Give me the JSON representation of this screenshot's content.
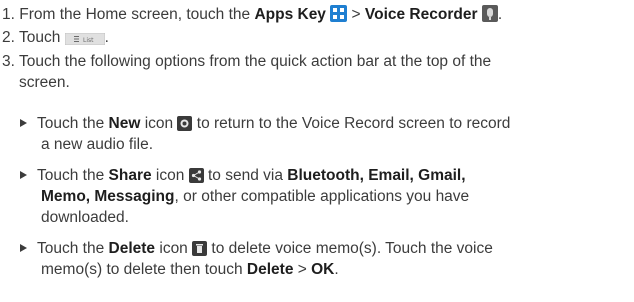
{
  "step1": {
    "num": "1.",
    "t1": "From the Home screen, touch the ",
    "apps_key": "Apps Key",
    "gt": " > ",
    "voice_recorder": "Voice Recorder",
    "t2": "."
  },
  "step2": {
    "num": "2.",
    "t1": "Touch ",
    "list_button": "List",
    "t2": "."
  },
  "step3": {
    "num": "3.",
    "line1": "Touch the following options from the quick action bar at the top of the",
    "line2": "screen."
  },
  "bullet_new": {
    "t1": "Touch the ",
    "b1": "New",
    "t2": " icon ",
    "t3": " to return to the Voice Record screen to record",
    "line2": "a new audio file."
  },
  "bullet_share": {
    "t1": "Touch the ",
    "b1": "Share",
    "t2": " icon ",
    "t3": " to send via ",
    "b2": "Bluetooth, Email, Gmail,",
    "b3": "Memo, Messaging",
    "t4": ", or other compatible applications you have",
    "line3": "downloaded."
  },
  "bullet_delete": {
    "t1": "Touch the ",
    "b1": "Delete",
    "t2": " icon ",
    "t3": " to delete voice memo(s). Touch the voice",
    "t4": "memo(s) to delete then touch ",
    "b2": "Delete",
    "gt": " > ",
    "b3": "OK",
    "t5": "."
  },
  "icons": {
    "apps_key": "apps-grid-icon",
    "voice_recorder": "voice-recorder-app-icon",
    "new": "new-record-icon",
    "share": "share-icon",
    "delete": "trash-icon"
  },
  "colors": {
    "text": "#3c3c3c",
    "apps_key_icon": "#1f7fd1",
    "icon_dark": "#3a3a3a"
  }
}
